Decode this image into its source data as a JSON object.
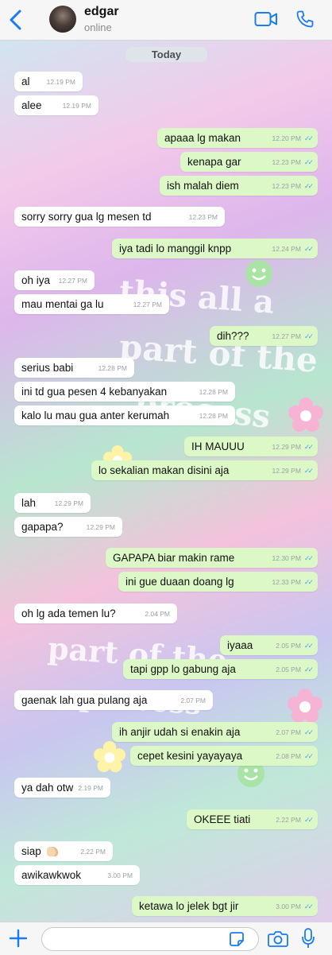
{
  "header": {
    "contact_name": "edgar",
    "status": "online"
  },
  "date_chip": "Today",
  "messages": [
    {
      "text": "al",
      "time": "12.19 PM",
      "dir": "in"
    },
    {
      "text": "alee",
      "time": "12.19 PM",
      "dir": "in"
    },
    {
      "text": "apaaa lg makan",
      "time": "12.20 PM",
      "dir": "out"
    },
    {
      "text": "kenapa gar",
      "time": "12.23 PM",
      "dir": "out"
    },
    {
      "text": "ish malah diem",
      "time": "12.23 PM",
      "dir": "out"
    },
    {
      "text": "sorry sorry gua lg mesen td",
      "time": "12.23 PM",
      "dir": "in"
    },
    {
      "text": "iya tadi lo manggil knpp",
      "time": "12.24 PM",
      "dir": "out"
    },
    {
      "text": "oh iya",
      "time": "12.27 PM",
      "dir": "in"
    },
    {
      "text": "mau mentai ga lu",
      "time": "12.27 PM",
      "dir": "in"
    },
    {
      "text": "dih???",
      "time": "12.27 PM",
      "dir": "out"
    },
    {
      "text": "serius babi",
      "time": "12.28 PM",
      "dir": "in"
    },
    {
      "text": "ini td gua pesen 4 kebanyakan",
      "time": "12.28 PM",
      "dir": "in"
    },
    {
      "text": "kalo lu mau gua anter kerumah",
      "time": "12.28 PM",
      "dir": "in"
    },
    {
      "text": "IH MAUUU",
      "time": "12.29 PM",
      "dir": "out"
    },
    {
      "text": "lo sekalian makan disini aja",
      "time": "12.29 PM",
      "dir": "out"
    },
    {
      "text": "lah",
      "time": "12.29 PM",
      "dir": "in"
    },
    {
      "text": "gapapa?",
      "time": "12.29 PM",
      "dir": "in"
    },
    {
      "text": "GAPAPA biar makin rame",
      "time": "12.30 PM",
      "dir": "out"
    },
    {
      "text": "ini gue duaan doang lg",
      "time": "12.33 PM",
      "dir": "out"
    },
    {
      "text": "oh lg ada temen lu?",
      "time": "2.04 PM",
      "dir": "in"
    },
    {
      "text": "iyaaa",
      "time": "2.05 PM",
      "dir": "out"
    },
    {
      "text": "tapi gpp lo gabung aja",
      "time": "2.05 PM",
      "dir": "out"
    },
    {
      "text": "gaenak lah gua pulang aja",
      "time": "2.07 PM",
      "dir": "in"
    },
    {
      "text": "ih anjir udah si enakin aja",
      "time": "2.07 PM",
      "dir": "out"
    },
    {
      "text": "cepet kesini yayayaya",
      "time": "2.08 PM",
      "dir": "out"
    },
    {
      "text": "ya dah otw",
      "time": "2.19 PM",
      "dir": "in"
    },
    {
      "text": "OKEEE tiati",
      "time": "2.22 PM",
      "dir": "out"
    },
    {
      "text": "siap",
      "time": "2.22 PM",
      "dir": "in",
      "emoji": "thumbs-up"
    },
    {
      "text": "awikawkwok",
      "time": "3.00 PM",
      "dir": "in"
    },
    {
      "text": "ketawa lo jelek bgt jir",
      "time": "3.00 PM",
      "dir": "out"
    }
  ],
  "background_text": [
    "this all a",
    "part of the",
    "process",
    "part of the",
    "process"
  ],
  "colors": {
    "accent": "#1a7cf5",
    "bubble_in": "#ffffff",
    "bubble_out": "#dcf8c6",
    "read_check": "#4fa3f0"
  },
  "icons": [
    "back-chevron-icon",
    "video-call-icon",
    "phone-call-icon",
    "plus-icon",
    "sticker-icon",
    "camera-icon",
    "microphone-icon"
  ]
}
